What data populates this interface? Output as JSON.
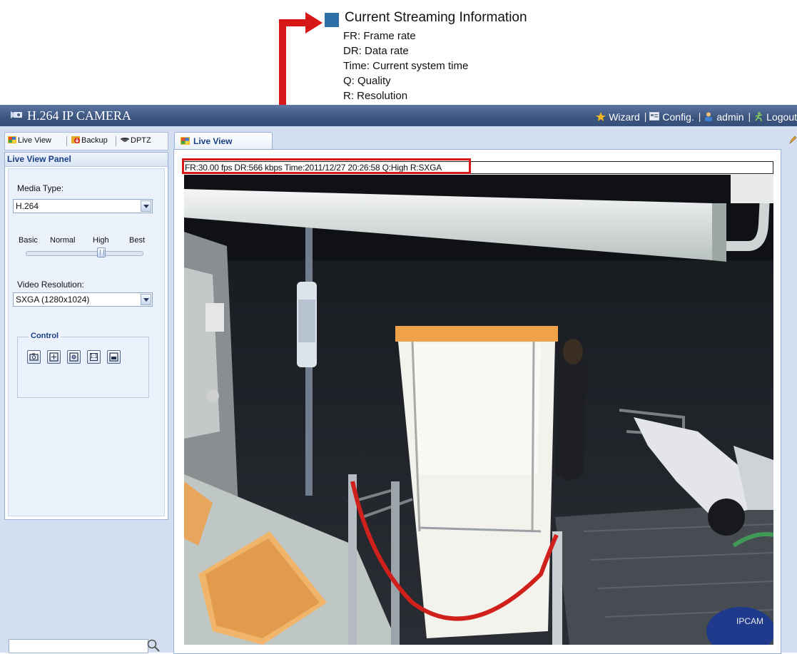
{
  "annotation": {
    "title": "Current Streaming Information",
    "items": [
      "FR: Frame rate",
      "DR: Data rate",
      "Time: Current system time",
      "Q: Quality",
      "R: Resolution"
    ],
    "accent_color": "#2f6fa8",
    "arrow_color": "#d61818"
  },
  "app": {
    "title": "H.264 IP CAMERA",
    "header_links": {
      "wizard": "Wizard",
      "config": "Config.",
      "user": "admin",
      "logout": "Logout"
    }
  },
  "left_tabs": {
    "live_view": "Live View",
    "backup": "Backup",
    "dptz": "DPTZ"
  },
  "panel": {
    "title": "Live View Panel",
    "media_type_label": "Media Type:",
    "media_type_value": "H.264",
    "quality_levels": [
      "Basic",
      "Normal",
      "High",
      "Best"
    ],
    "quality_selected": "High",
    "resolution_label": "Video Resolution:",
    "resolution_value": "SXGA (1280x1024)",
    "control_legend": "Control",
    "control_buttons": [
      "snapshot-icon",
      "fullscreen-icon",
      "zoom-icon",
      "actual-size-icon",
      "fit-window-icon"
    ],
    "actual_size_text": "1:1"
  },
  "live_view": {
    "tab_label": "Live View",
    "info_text": "FR:30.00 fps  DR:566 kbps Time:2011/12/27 20:26:58 Q:High R:SXGA",
    "watermark": "IPCAM"
  }
}
